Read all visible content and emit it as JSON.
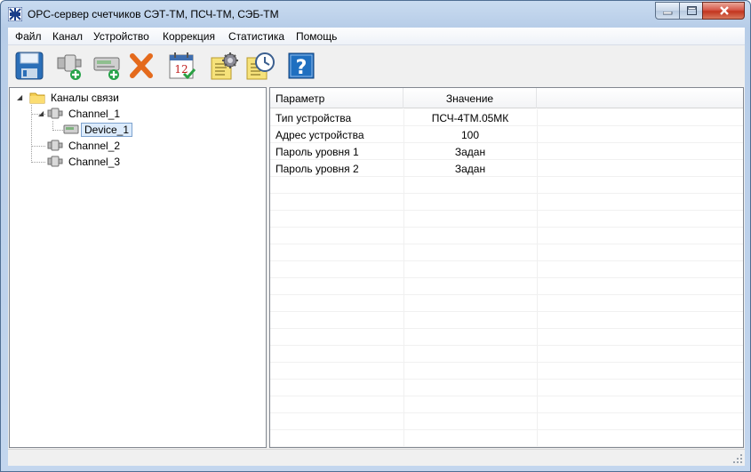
{
  "window": {
    "title": "OPC-сервер счетчиков СЭТ-ТМ, ПСЧ-ТМ, СЭБ-ТМ",
    "app_icon": "network-logo-icon"
  },
  "menu": {
    "items": [
      {
        "label": "Файл"
      },
      {
        "label": "Канал"
      },
      {
        "label": "Устройство"
      },
      {
        "label": "Коррекция"
      },
      {
        "label": "Статистика"
      },
      {
        "label": "Помощь"
      }
    ]
  },
  "toolbar": {
    "buttons": [
      {
        "icon": "save-icon"
      },
      {
        "icon": "add-channel-icon"
      },
      {
        "icon": "add-device-icon"
      },
      {
        "icon": "delete-icon"
      },
      {
        "icon": "calendar-icon"
      },
      {
        "icon": "settings-icon"
      },
      {
        "icon": "clock-icon"
      },
      {
        "icon": "help-icon"
      }
    ],
    "calendar_day": "12"
  },
  "tree": {
    "root": {
      "label": "Каналы связи",
      "icon": "folder-icon"
    },
    "channels": [
      {
        "label": "Channel_1",
        "expanded": true,
        "devices": [
          {
            "label": "Device_1",
            "selected": true
          }
        ]
      },
      {
        "label": "Channel_2",
        "expanded": false,
        "devices": []
      },
      {
        "label": "Channel_3",
        "expanded": false,
        "devices": []
      }
    ]
  },
  "list": {
    "columns": [
      "Параметр",
      "Значение"
    ],
    "rows": [
      {
        "param": "Тип устройства",
        "value": "ПСЧ-4ТМ.05МК"
      },
      {
        "param": "Адрес устройства",
        "value": "100"
      },
      {
        "param": "Пароль уровня 1",
        "value": "Задан"
      },
      {
        "param": "Пароль уровня 2",
        "value": "Задан"
      }
    ]
  },
  "colors": {
    "accent_selection": "#dcebfc",
    "close_button": "#c2351f",
    "help_blue": "#1f6fc0"
  }
}
